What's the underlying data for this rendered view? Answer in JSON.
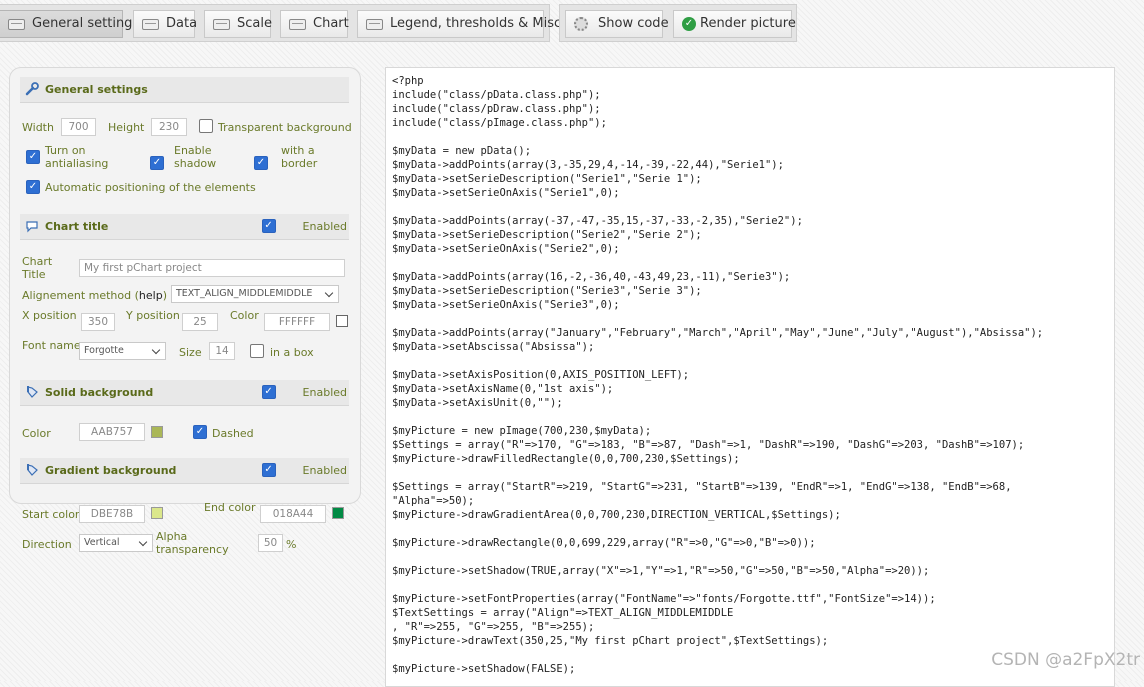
{
  "toolbar": {
    "tabs": [
      "General settings",
      "Data",
      "Scale",
      "Chart",
      "Legend, thresholds & Misc"
    ],
    "show_code": "Show code",
    "render_picture": "Render picture"
  },
  "general": {
    "title": "General settings",
    "width_label": "Width",
    "width_value": "700",
    "height_label": "Height",
    "height_value": "230",
    "transparent_label": "Transparent background",
    "antialias_label": "Turn on antialiasing",
    "shadow_label": "Enable shadow",
    "border_label": "with a border",
    "autopos_label": "Automatic positioning of the elements"
  },
  "chart_title": {
    "title": "Chart title",
    "enabled": "Enabled",
    "label": "Chart Title",
    "value": "My first pChart project",
    "align_label": "Alignement method (",
    "align_help": "help",
    "align_close": ")",
    "align_value": "TEXT_ALIGN_MIDDLEMIDDLE",
    "x_label": "X position",
    "x_value": "350",
    "y_label": "Y position",
    "y_value": "25",
    "color_label": "Color",
    "color_value": "FFFFFF",
    "font_label": "Font name",
    "font_value": "Forgotte",
    "size_label": "Size",
    "size_value": "14",
    "box_label": "in a box"
  },
  "solid_bg": {
    "title": "Solid background",
    "enabled": "Enabled",
    "color_label": "Color",
    "color_value": "AAB757",
    "swatch": "#AAB757",
    "dashed_label": "Dashed"
  },
  "gradient_bg": {
    "title": "Gradient background",
    "enabled": "Enabled",
    "start_label": "Start color",
    "start_value": "DBE78B",
    "start_swatch": "#DBE78B",
    "end_label": "End color",
    "end_value": "018A44",
    "end_swatch": "#018A44",
    "direction_label": "Direction",
    "direction_value": "Vertical",
    "alpha_label": "Alpha transparency",
    "alpha_value": "50",
    "alpha_unit": "%"
  },
  "code_lines": [
    "<?php",
    "include(\"class/pData.class.php\");",
    "include(\"class/pDraw.class.php\");",
    "include(\"class/pImage.class.php\");",
    "",
    "$myData = new pData();",
    "$myData->addPoints(array(3,-35,29,4,-14,-39,-22,44),\"Serie1\");",
    "$myData->setSerieDescription(\"Serie1\",\"Serie 1\");",
    "$myData->setSerieOnAxis(\"Serie1\",0);",
    "",
    "$myData->addPoints(array(-37,-47,-35,15,-37,-33,-2,35),\"Serie2\");",
    "$myData->setSerieDescription(\"Serie2\",\"Serie 2\");",
    "$myData->setSerieOnAxis(\"Serie2\",0);",
    "",
    "$myData->addPoints(array(16,-2,-36,40,-43,49,23,-11),\"Serie3\");",
    "$myData->setSerieDescription(\"Serie3\",\"Serie 3\");",
    "$myData->setSerieOnAxis(\"Serie3\",0);",
    "",
    "$myData->addPoints(array(\"January\",\"February\",\"March\",\"April\",\"May\",\"June\",\"July\",\"August\"),\"Absissa\");",
    "$myData->setAbscissa(\"Absissa\");",
    "",
    "$myData->setAxisPosition(0,AXIS_POSITION_LEFT);",
    "$myData->setAxisName(0,\"1st axis\");",
    "$myData->setAxisUnit(0,\"\");",
    "",
    "$myPicture = new pImage(700,230,$myData);",
    "$Settings = array(\"R\"=>170, \"G\"=>183, \"B\"=>87, \"Dash\"=>1, \"DashR\"=>190, \"DashG\"=>203, \"DashB\"=>107);",
    "$myPicture->drawFilledRectangle(0,0,700,230,$Settings);",
    "",
    "$Settings = array(\"StartR\"=>219, \"StartG\"=>231, \"StartB\"=>139, \"EndR\"=>1, \"EndG\"=>138, \"EndB\"=>68,",
    "\"Alpha\"=>50);",
    "$myPicture->drawGradientArea(0,0,700,230,DIRECTION_VERTICAL,$Settings);",
    "",
    "$myPicture->drawRectangle(0,0,699,229,array(\"R\"=>0,\"G\"=>0,\"B\"=>0));",
    "",
    "$myPicture->setShadow(TRUE,array(\"X\"=>1,\"Y\"=>1,\"R\"=>50,\"G\"=>50,\"B\"=>50,\"Alpha\"=>20));",
    "",
    "$myPicture->setFontProperties(array(\"FontName\"=>\"fonts/Forgotte.ttf\",\"FontSize\"=>14));",
    "$TextSettings = array(\"Align\"=>TEXT_ALIGN_MIDDLEMIDDLE",
    ", \"R\"=>255, \"G\"=>255, \"B\"=>255);",
    "$myPicture->drawText(350,25,\"My first pChart project\",$TextSettings);",
    "",
    "$myPicture->setShadow(FALSE);"
  ],
  "watermark": "CSDN @a2FpX2tr"
}
